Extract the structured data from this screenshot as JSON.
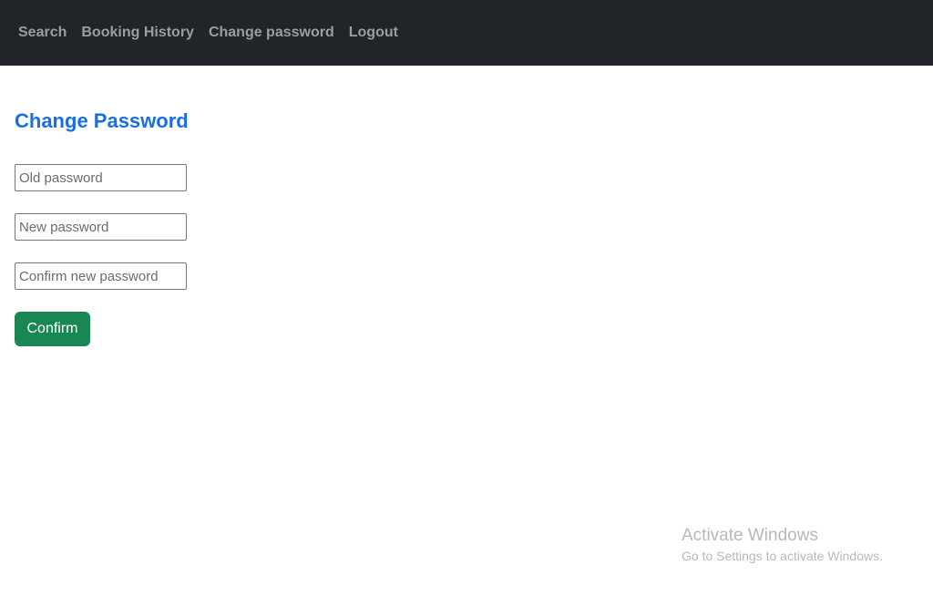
{
  "nav": {
    "items": [
      {
        "label": "Search"
      },
      {
        "label": "Booking History"
      },
      {
        "label": "Change password"
      },
      {
        "label": "Logout"
      }
    ]
  },
  "page": {
    "title": "Change Password"
  },
  "form": {
    "old_password_placeholder": "Old password",
    "new_password_placeholder": "New password",
    "confirm_password_placeholder": "Confirm new password",
    "confirm_label": "Confirm"
  },
  "watermark": {
    "title": "Activate Windows",
    "subtitle": "Go to Settings to activate Windows."
  },
  "colors": {
    "navbar_bg": "#212529",
    "nav_text": "#9a9da1",
    "title": "#1a6ee5",
    "confirm_button": "#198754"
  }
}
